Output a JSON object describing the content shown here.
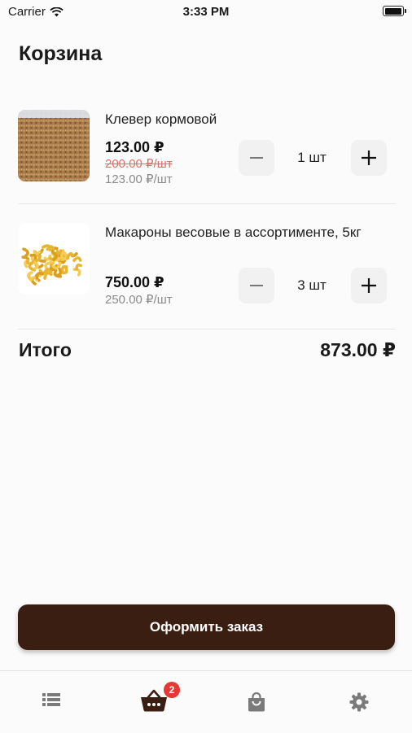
{
  "status_bar": {
    "carrier": "Carrier",
    "time": "3:33 PM",
    "battery_level": 1.0
  },
  "page": {
    "title": "Корзина"
  },
  "cart": {
    "items": [
      {
        "name": "Клевер кормовой",
        "price": "123.00 ₽",
        "old_price": "200.00 ₽/шт",
        "unit_price": "123.00 ₽/шт",
        "quantity": "1 шт",
        "image": "clover-seeds-photo"
      },
      {
        "name": "Макароны весовые в ассортименте, 5кг",
        "price": "750.00 ₽",
        "unit_price": "250.00 ₽/шт",
        "quantity": "3 шт",
        "image": "pasta-photo"
      }
    ],
    "total_label": "Итого",
    "total_value": "873.00 ₽"
  },
  "checkout": {
    "label": "Оформить заказ",
    "color": "#3a1e12"
  },
  "tabbar": {
    "tabs": [
      {
        "icon": "list-icon",
        "color": "#7a7a7a"
      },
      {
        "icon": "basket-icon",
        "color": "#3a1e12",
        "badge": "2",
        "active": true
      },
      {
        "icon": "shopping-bag-icon",
        "color": "#7a7a7a"
      },
      {
        "icon": "gear-icon",
        "color": "#7a7a7a"
      }
    ],
    "badge_color": "#e53935"
  }
}
